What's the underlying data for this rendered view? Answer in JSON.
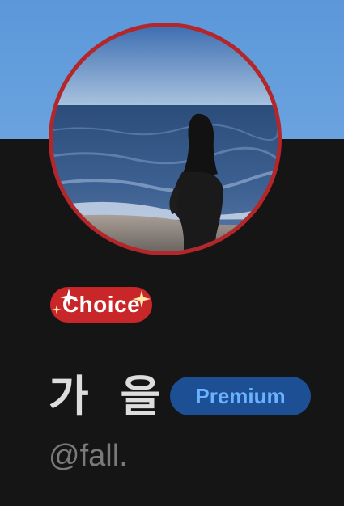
{
  "profile": {
    "display_name": "가 을",
    "handle": "@fall.",
    "choice_label": "Choice",
    "premium_label": "Premium"
  },
  "images": {
    "banner": "sky-banner",
    "avatar": "person-facing-sea-photo"
  },
  "icons": {
    "choice_decoration": "sparkle-icon"
  },
  "colors": {
    "background": "#151515",
    "banner_sky": "#5b97da",
    "avatar_ring": "#b3262a",
    "choice_badge": "#c9262a",
    "premium_badge_bg": "#1d4f94",
    "premium_text": "#6ab1ff",
    "name_text": "#dddddd",
    "handle_text": "#7a7a7a"
  }
}
